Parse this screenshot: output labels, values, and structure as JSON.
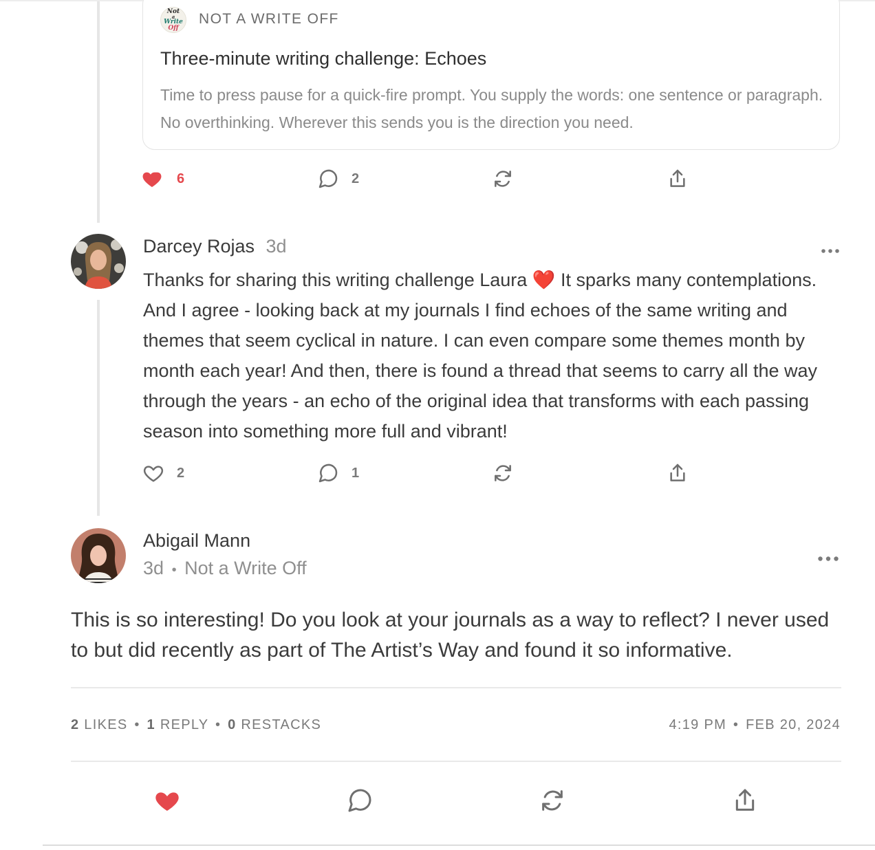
{
  "embed": {
    "publication_name": "NOT A WRITE OFF",
    "logo_text": [
      "Not",
      "a",
      "Write",
      "Off"
    ],
    "title": "Three-minute writing challenge: Echoes",
    "subtitle": "Time to press pause for a quick-fire prompt. You supply the words: one sentence or paragraph. No overthinking. Wherever this sends you is the direction you need."
  },
  "post_actions": {
    "likes": "6",
    "comments": "2",
    "liked": true
  },
  "comment1": {
    "author": "Darcey Rojas",
    "age": "3d",
    "text_a": "Thanks for sharing this writing challenge Laura ",
    "emoji": "❤️",
    "text_b": " It sparks many contemplations. And I agree - looking back at my journals I find echoes of the same writing and themes that seem cyclical in nature. I can even compare some themes month by month each year! And then, there is found a thread that seems to carry all the way through the years - an echo of the original idea that transforms with each passing season into something more full and vibrant!",
    "likes": "2",
    "comments": "1",
    "liked": false
  },
  "comment2": {
    "author": "Abigail Mann",
    "age": "3d",
    "separator": "•",
    "publication": "Not a Write Off",
    "text": "This is so interesting! Do you look at your journals as a way to reflect? I never used to but did recently as part of The Artist’s Way and found it so informative."
  },
  "stats": {
    "likes_num": "2",
    "likes_label": "LIKES",
    "replies_num": "1",
    "replies_label": "REPLY",
    "restacks_num": "0",
    "restacks_label": "RESTACKS",
    "dot": "•",
    "time": "4:19 PM",
    "date": "FEB 20, 2024"
  },
  "colors": {
    "like_red": "#e5484d",
    "icon_gray": "#6f6f6f",
    "line_gray": "#e6e6e6"
  },
  "icons": [
    "heart-icon",
    "comment-icon",
    "restack-icon",
    "share-icon",
    "more-icon"
  ]
}
